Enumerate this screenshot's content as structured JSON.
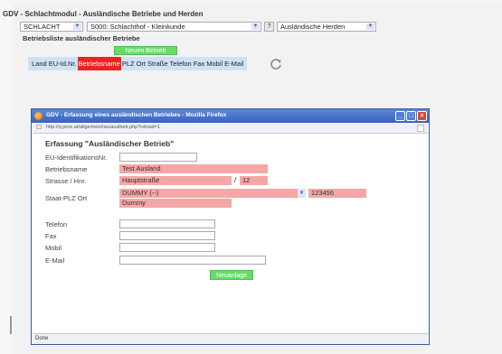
{
  "app": {
    "title": "GDV - Schlachtmodul - Ausländische Betriebe und Herden"
  },
  "filters": {
    "type_select": "SCHLACHT",
    "plant_select": "S000: Schlachthof - Kleinkunde",
    "help_label": "?",
    "view_select": "Ausländische Herden"
  },
  "list": {
    "title": "Betriebsliste ausländischer Betriebe",
    "new_button": "Neuen Betrieb anlegen",
    "columns": [
      "Land",
      "EU-Id.Nr.",
      "Betriebsname",
      "PLZ",
      "Ort",
      "Straße",
      "Telefon",
      "Fax",
      "Mobil",
      "E-Mail"
    ],
    "active_column": "Betriebsname"
  },
  "popup": {
    "window_title": "GDV - Erfassung eines ausländischen Betriebes - Mozilla Firefox",
    "address": "http://q.pore.at/allgemein/neuauslbetr.php?reload=1",
    "heading": "Erfassung \"Ausländischer Betrieb\"",
    "labels": {
      "eu_id": "EU-IdentifikationsNr.",
      "name": "Betriebsname",
      "street": "Strasse / Hnr.",
      "country_zip_city": "Staat-PLZ Ort",
      "phone": "Telefon",
      "fax": "Fax",
      "mobile": "Mobil",
      "email": "E-Mail"
    },
    "values": {
      "eu_id": "",
      "name": "Test Ausland",
      "street": "Hauptstraße",
      "house_number": "12",
      "country": "DUMMY (--)",
      "zip": "123456",
      "city": "Dummy",
      "phone": "",
      "fax": "",
      "mobile": "",
      "email": ""
    },
    "slash": "/",
    "submit_button": "Neuanlage",
    "status": "Done"
  },
  "colors": {
    "required_field": "#f5a6a6",
    "green_button": "#66dd66",
    "active_column": "#ee2222",
    "column_bar": "#cfe2f5",
    "titlebar": "#3763c0"
  },
  "icons": {
    "refresh": "refresh-icon",
    "firefox": "firefox-icon",
    "dropdown": "chevron-down-icon"
  }
}
